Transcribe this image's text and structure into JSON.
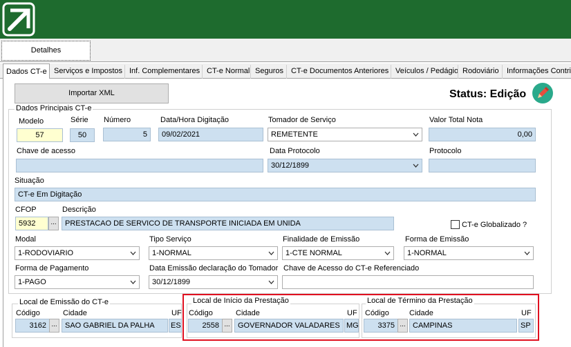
{
  "tabs": {
    "outer": [
      "Detalhes"
    ],
    "inner": [
      "Dados CT-e",
      "Serviços e Impostos",
      "Inf. Complementares",
      "CT-e Normal",
      "Seguros",
      "CT-e Documentos Anteriores",
      "Veículos / Pedágio",
      "Rodoviário",
      "Informações Contril"
    ]
  },
  "import_button": "Importar XML",
  "status": "Status: Edição",
  "dados": {
    "group_title": "Dados Principais CT-e",
    "modelo_label": "Modelo",
    "modelo": "57",
    "serie_label": "Série",
    "serie": "50",
    "numero_label": "Número",
    "numero": "5",
    "data_hora_label": "Data/Hora Digitação",
    "data_hora": "09/02/2021",
    "tomador_label": "Tomador de Serviço",
    "tomador": "REMETENTE",
    "valor_total_label": "Valor Total Nota",
    "valor_total": "0,00",
    "chave_label": "Chave de acesso",
    "chave": "",
    "data_protocolo_label": "Data Protocolo",
    "data_protocolo": "30/12/1899",
    "protocolo_label": "Protocolo",
    "protocolo": "",
    "situacao_label": "Situação",
    "situacao": "CT-e Em Digitação",
    "cfop_label": "CFOP",
    "cfop": "5932",
    "descricao_label": "Descrição",
    "descricao": "PRESTACAO DE SERVICO DE TRANSPORTE INICIADA EM UNIDA",
    "globalizado_label": "CT-e Globalizado ?",
    "modal_label": "Modal",
    "modal": "1-RODOVIARIO",
    "tipo_servico_label": "Tipo Serviço",
    "tipo_servico": "1-NORMAL",
    "finalidade_label": "Finalidade de Emissão",
    "finalidade": "1-CTE NORMAL",
    "forma_emissao_label": "Forma de Emissão",
    "forma_emissao": "1-NORMAL",
    "forma_pagamento_label": "Forma de Pagamento",
    "forma_pagamento": "1-PAGO",
    "data_emissao_tomador_label": "Data Emissão declaração do Tomador",
    "data_emissao_tomador": "30/12/1899",
    "chave_referenciado_label": "Chave de Acesso do CT-e Referenciado",
    "chave_referenciado": ""
  },
  "locais": {
    "emissao": {
      "title": "Local de Emissão do CT-e",
      "codigo_label": "Código",
      "cidade_label": "Cidade",
      "uf_label": "UF",
      "codigo": "3162",
      "cidade": "SAO GABRIEL DA PALHA",
      "uf": "ES"
    },
    "inicio": {
      "title": "Local de Início da Prestação",
      "codigo_label": "Código",
      "cidade_label": "Cidade",
      "uf_label": "UF",
      "codigo": "2558",
      "cidade": "GOVERNADOR VALADARES",
      "uf": "MG"
    },
    "termino": {
      "title": "Local de Término da Prestação",
      "codigo_label": "Código",
      "cidade_label": "Cidade",
      "uf_label": "UF",
      "codigo": "3375",
      "cidade": "CAMPINAS",
      "uf": "SP"
    }
  },
  "ellipsis": "...",
  "colors": {
    "header": "#1e6b2e",
    "field_bg": "#cde0f0",
    "required_bg": "#ffffd0",
    "highlight": "#e01020",
    "status_icon": "#2aa98b"
  },
  "icons": {
    "logo": "arrow-up-right-logo",
    "status": "pencil-icon",
    "combo": "chevron-down-icon"
  }
}
